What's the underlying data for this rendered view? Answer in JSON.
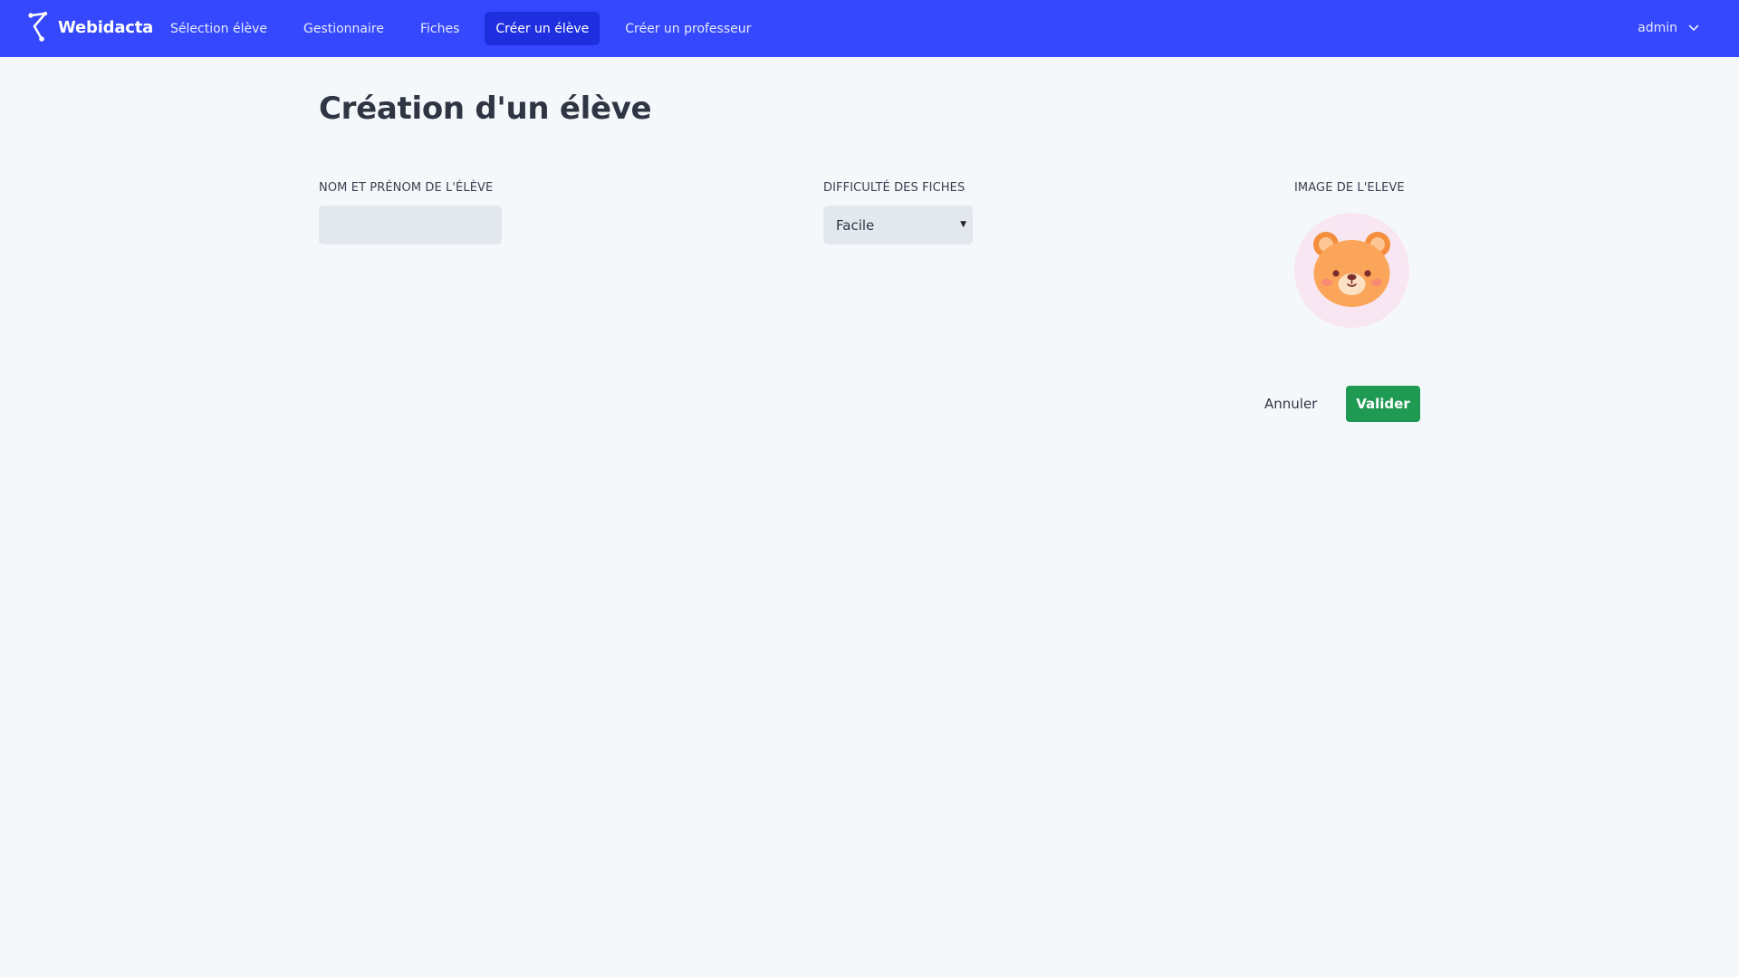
{
  "brand": {
    "name": "Webidacta",
    "logo_icon": "network-branch-icon"
  },
  "nav": {
    "items": [
      {
        "label": "Sélection élève",
        "active": false
      },
      {
        "label": "Gestionnaire",
        "active": false
      },
      {
        "label": "Fiches",
        "active": false
      },
      {
        "label": "Créer un élève",
        "active": true
      },
      {
        "label": "Créer un professeur",
        "active": false
      }
    ]
  },
  "user_menu": {
    "username": "admin",
    "icon": "chevron-down-icon"
  },
  "page": {
    "title": "Création d'un élève"
  },
  "form": {
    "name_field": {
      "label": "NOM ET PRÉNOM DE L'ÉLÈVE",
      "value": "",
      "placeholder": ""
    },
    "difficulty_field": {
      "label": "DIFFICULTÉ DES FICHES",
      "selected": "Facile"
    },
    "image_field": {
      "label": "IMAGE DE L'ELEVE",
      "avatar_icon": "bear-avatar-icon"
    },
    "cancel_label": "Annuler",
    "submit_label": "Valider"
  },
  "colors": {
    "navbar": "#3548fd",
    "nav_active": "#1f2fe0",
    "background": "#f5f8fb",
    "input_bg": "#e3e8ef",
    "submit": "#1e9a52",
    "avatar_bg": "#f8e6f2",
    "bear": "#fba55a"
  }
}
